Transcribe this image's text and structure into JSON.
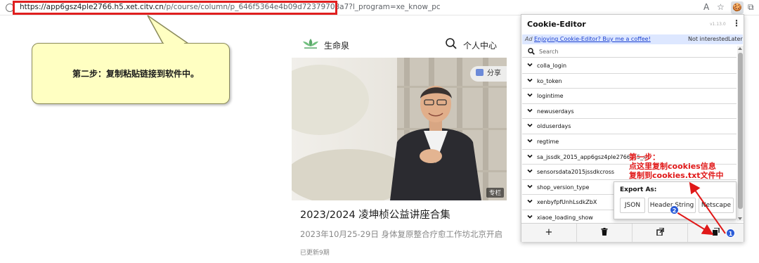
{
  "browser": {
    "url_host": "https://app6gsz4ple2766.h5.xet.citv.cn",
    "url_rest": "/p/course/column/p_646f5364e4b09d72379708a7?l_program=xe_know_pc",
    "ext_icon": "cookie-icon"
  },
  "callout": {
    "text": "第二步：复制粘贴链接到软件中。"
  },
  "site": {
    "name": "生命泉",
    "user_center": "个人中心",
    "share_label": "分享",
    "tag_label": "专栏",
    "course_title": "2023/2024 凌坤桢公益讲座合集",
    "course_subtitle": "2023年10月25-29日 身体复原整合疗愈工作坊北京开启",
    "course_updated": "已更新9期"
  },
  "cookie_editor": {
    "title": "Cookie-Editor",
    "version": "v1.13.0",
    "menu_label": "⋮",
    "ad_tag": "Ad",
    "ad_link": "Enjoying Cookie-Editor? Buy me a coffee!",
    "ad_not_interested": "Not interested",
    "ad_later": "Later",
    "search_placeholder": "Search",
    "cookies": [
      "colla_login",
      "ko_token",
      "logintime",
      "newuserdays",
      "olduserdays",
      "regtime",
      "sa_jssdk_2015_app6gsz4ple2766_h5_xe",
      "sensorsdata2015jssdkcross",
      "shop_version_type",
      "xenbyfpfUnhLsdkZbX",
      "xiaoe_loading_show"
    ],
    "footer": {
      "add": "+",
      "delete": "🗑",
      "import": "⇲",
      "export": "⇱"
    },
    "export": {
      "label": "Export As:",
      "json": "JSON",
      "header_string": "Header String",
      "netscape": "Netscape"
    }
  },
  "annotation": {
    "step1_line1": "第一步：",
    "step1_line2": "点这里复制cookies信息",
    "step1_line3": "复制到cookies.txt文件中",
    "badge1": "1",
    "badge2": "2",
    "color": "#e01818"
  }
}
